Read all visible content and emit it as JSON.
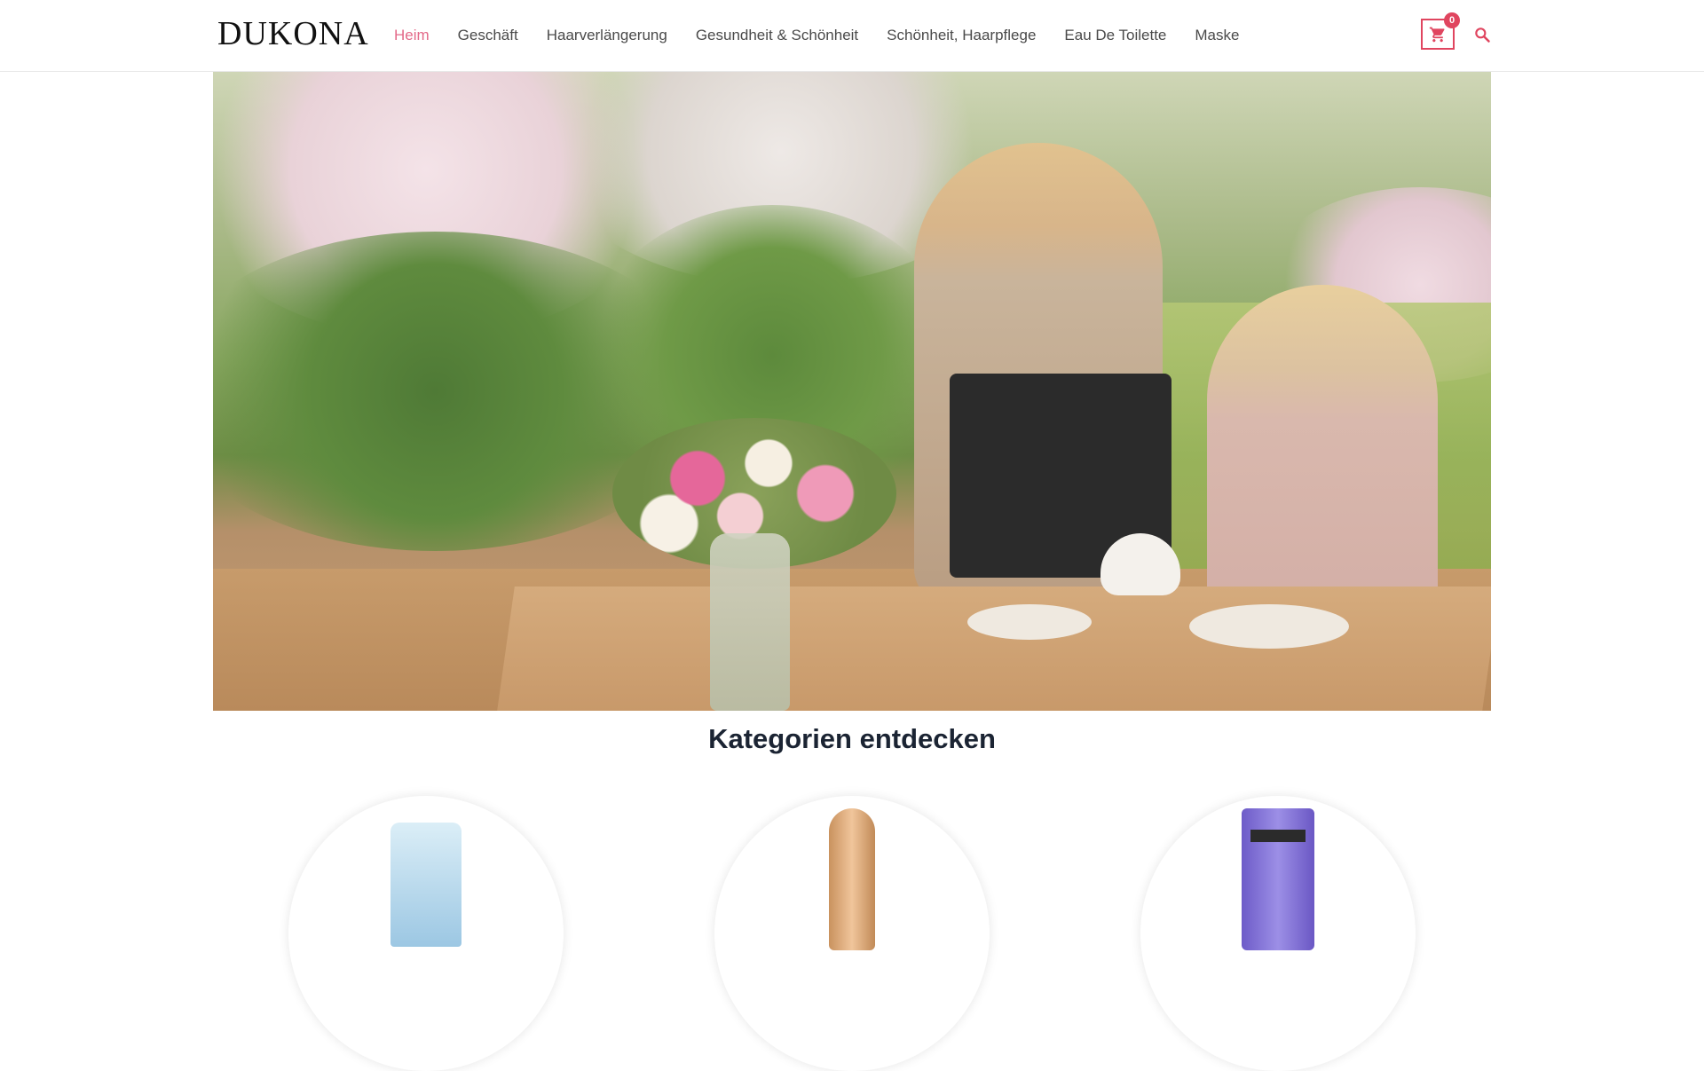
{
  "header": {
    "logo": "DUKONA",
    "nav": [
      {
        "label": "Heim",
        "active": true
      },
      {
        "label": "Geschäft",
        "active": false
      },
      {
        "label": "Haarverlängerung",
        "active": false
      },
      {
        "label": "Gesundheit & Schönheit",
        "active": false
      },
      {
        "label": "Schönheit, Haarpflege",
        "active": false
      },
      {
        "label": "Eau De Toilette",
        "active": false
      },
      {
        "label": "Maske",
        "active": false
      }
    ],
    "cart_count": "0",
    "icons": {
      "cart": "cart-icon",
      "search": "search-icon"
    }
  },
  "hero": {
    "image": "garden-tea-scene-photo"
  },
  "categories": {
    "title": "Kategorien entdecken",
    "items": [
      {
        "image": "blue-spray-bottle"
      },
      {
        "image": "gold-tube-product"
      },
      {
        "image": "purple-hair-tube"
      }
    ]
  },
  "colors": {
    "accent": "#e36a89",
    "cart_border": "#e0455f",
    "title": "#1b2433"
  }
}
